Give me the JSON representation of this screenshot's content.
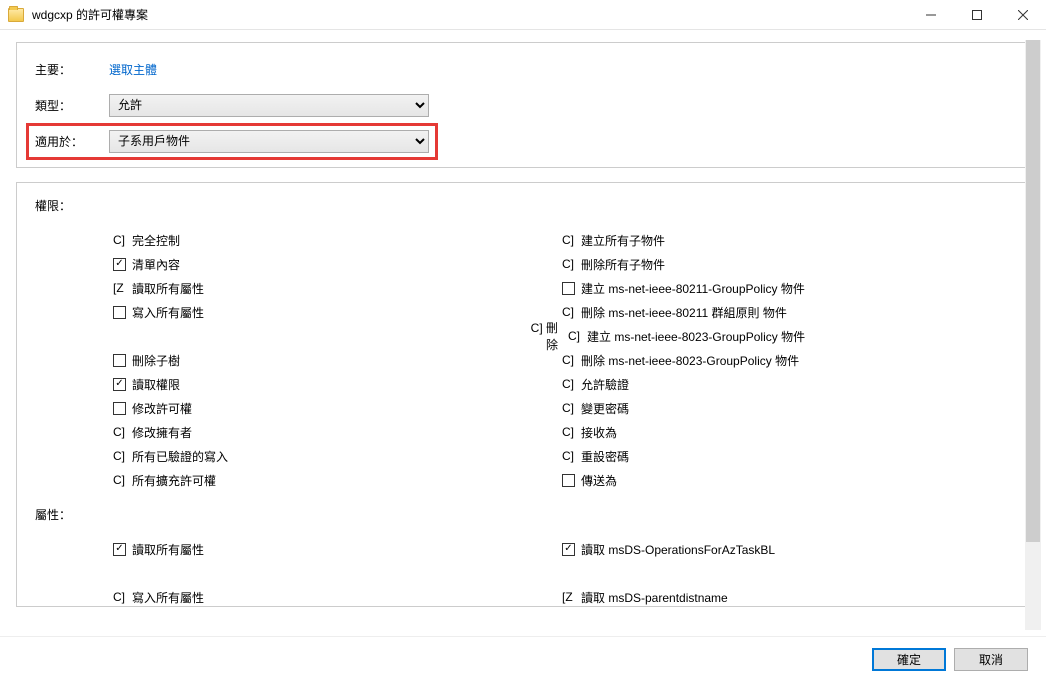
{
  "window": {
    "title": "wdgcxp 的許可權專案",
    "min_label": "─",
    "max_label": "☐",
    "close_label": "✕"
  },
  "top": {
    "principal_label": "主要：",
    "principal_value": "選取主體",
    "type_label": "類型：",
    "type_value": "允許",
    "applies_label": "適用於：",
    "applies_value": "子系用戶物件"
  },
  "perms": {
    "label": "權限：",
    "left": [
      {
        "state": "C]",
        "text": "完全控制"
      },
      {
        "state": "chk",
        "text": "清單內容"
      },
      {
        "state": "[Z",
        "text": "讀取所有屬性"
      },
      {
        "state": "box",
        "text": "寫入所有屬性"
      },
      {
        "state": "blank"
      },
      {
        "state": "box",
        "text": "刪除子樹"
      },
      {
        "state": "chk",
        "text": "讀取權限"
      },
      {
        "state": "box",
        "text": "修改許可權"
      },
      {
        "state": "C]",
        "text": "修改擁有者"
      },
      {
        "state": "C]",
        "text": "所有已驗證的寫入"
      },
      {
        "state": "C]",
        "text": "所有擴充許可權"
      }
    ],
    "right": [
      {
        "state": "C]",
        "text": "建立所有子物件"
      },
      {
        "state": "C]",
        "text": "刪除所有子物件"
      },
      {
        "state": "box",
        "text": "建立 ms-net-ieee-80211-GroupPolicy 物件"
      },
      {
        "state": "C]",
        "text": "刪除 ms-net-ieee-80211 群組原則 物件"
      },
      {
        "state": "C]",
        "prefix": "C] 刪除",
        "text": "建立 ms-net-ieee-8023-GroupPolicy 物件"
      },
      {
        "state": "C]",
        "text": "刪除 ms-net-ieee-8023-GroupPolicy 物件"
      },
      {
        "state": "C]",
        "text": "允許驗證"
      },
      {
        "state": "C]",
        "text": "變更密碼"
      },
      {
        "state": "C]",
        "text": "接收為"
      },
      {
        "state": "C]",
        "text": "重設密碼"
      },
      {
        "state": "box",
        "text": "傳送為"
      }
    ]
  },
  "attrs": {
    "label": "屬性：",
    "left": [
      {
        "state": "chk",
        "text": "讀取所有屬性"
      },
      {
        "state": "blank"
      },
      {
        "state": "C]",
        "text": "寫入所有屬性"
      }
    ],
    "right": [
      {
        "state": "chk",
        "text": "讀取 msDS-OperationsForAzTaskBL"
      },
      {
        "state": "blank"
      },
      {
        "state": "[Z",
        "text": "讀取 msDS-parentdistname"
      }
    ]
  },
  "footer": {
    "ok": "確定",
    "cancel": "取消"
  }
}
